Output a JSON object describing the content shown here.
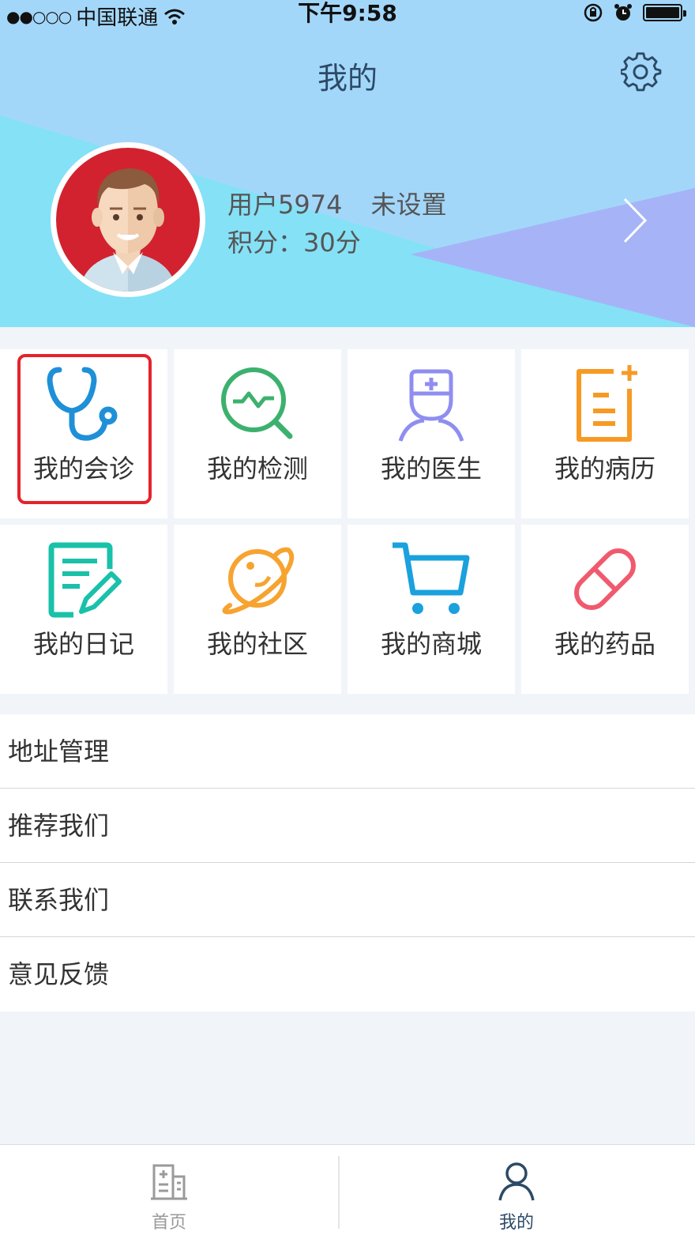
{
  "status_bar": {
    "signal": "●●○○○",
    "carrier": "中国联通",
    "time": "下午9:58"
  },
  "header": {
    "title": "我的",
    "settings_icon": "gear-icon",
    "user_name": "用户5974",
    "user_status": "未设置",
    "points_label": "积分：",
    "points_value": "30分"
  },
  "grid": [
    {
      "label": "我的会诊",
      "icon": "stethoscope-icon",
      "color": "#1e90d8",
      "highlighted": true
    },
    {
      "label": "我的检测",
      "icon": "monitor-search-icon",
      "color": "#3cb16e"
    },
    {
      "label": "我的医生",
      "icon": "doctor-icon",
      "color": "#8f8ef0"
    },
    {
      "label": "我的病历",
      "icon": "record-icon",
      "color": "#f79a24"
    },
    {
      "label": "我的日记",
      "icon": "diary-icon",
      "color": "#19c1a9"
    },
    {
      "label": "我的社区",
      "icon": "planet-icon",
      "color": "#f7a330"
    },
    {
      "label": "我的商城",
      "icon": "cart-icon",
      "color": "#1aa1de"
    },
    {
      "label": "我的药品",
      "icon": "pill-icon",
      "color": "#f05a6e"
    }
  ],
  "menu": [
    {
      "label": "地址管理"
    },
    {
      "label": "推荐我们"
    },
    {
      "label": "联系我们"
    },
    {
      "label": "意见反馈"
    }
  ],
  "tabbar": {
    "home_label": "首页",
    "mine_label": "我的",
    "active": "我的"
  },
  "colors": {
    "highlight_border": "#e5232b",
    "header_sky": "#a3d7fa",
    "header_cyan": "#85e1f6",
    "header_violet": "#a9b1f6",
    "avatar_bg": "#d2222f"
  }
}
